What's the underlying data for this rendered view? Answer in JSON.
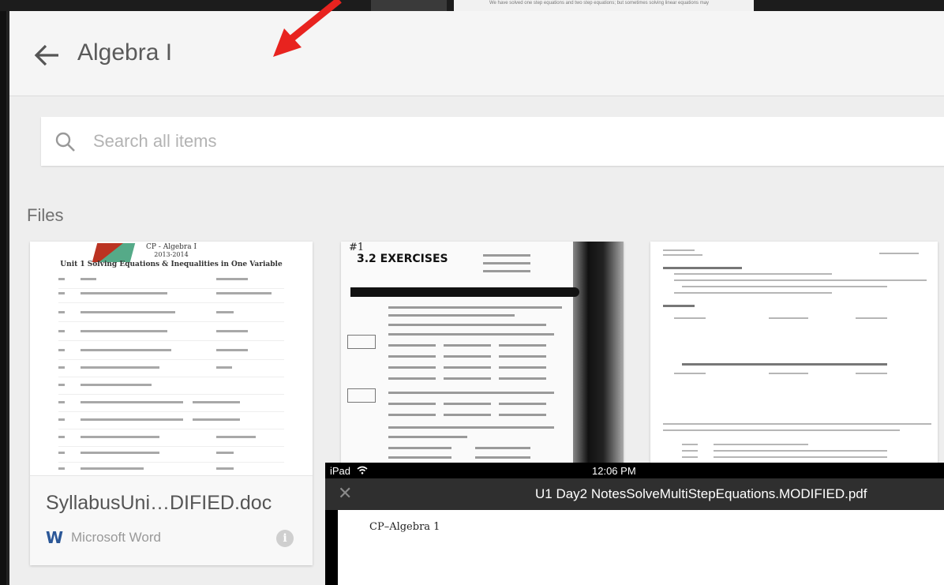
{
  "background_doc": {
    "snippet": "We have solved one step equations and two step equations; but sometimes solving linear equations may"
  },
  "header": {
    "back_icon": "arrow-left-icon",
    "title": "Algebra I"
  },
  "search": {
    "icon": "search-icon",
    "placeholder": "Search all items",
    "value": ""
  },
  "files_section": {
    "title": "Files"
  },
  "files": [
    {
      "name": "SyllabusUni…DIFIED.doc",
      "type": "Microsoft Word",
      "type_icon": "W",
      "thumb": {
        "heading1": "CP - Algebra I",
        "heading2": "2013-2014",
        "heading3": "Unit 1 Solving Equations & Inequalities in One Variable"
      }
    },
    {
      "thumb": {
        "handwriting": "#1",
        "title": "3.2 EXERCISES"
      }
    },
    {
      "thumb": {}
    }
  ],
  "overlay": {
    "device": "iPad",
    "time": "12:06 PM",
    "close_icon": "close-icon",
    "title": "U1 Day2 NotesSolveMultiStepEquations.MODIFIED.pdf",
    "page_text": "CP–Algebra 1"
  },
  "annotation": {
    "arrow_color": "#e8231f"
  }
}
